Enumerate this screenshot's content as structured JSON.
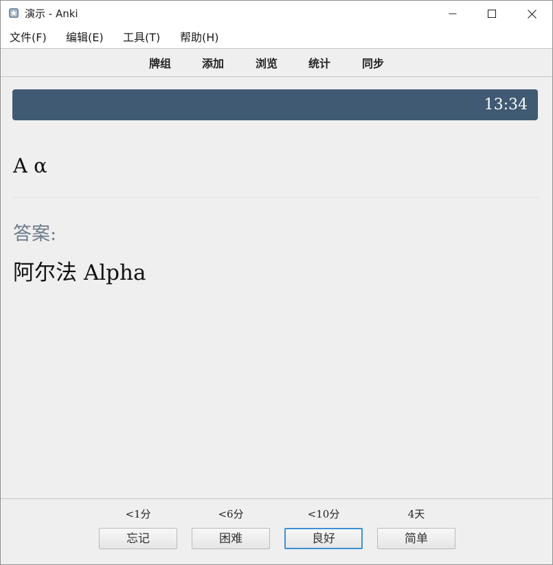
{
  "window": {
    "title": "演示 - Anki",
    "icon": "anki-app-icon"
  },
  "menu": [
    "文件(F)",
    "编辑(E)",
    "工具(T)",
    "帮助(H)"
  ],
  "toolbar": [
    "牌组",
    "添加",
    "浏览",
    "统计",
    "同步"
  ],
  "timer": "13:34",
  "card": {
    "question": "A α",
    "answer_label": "答案:",
    "answer": "阿尔法 Alpha"
  },
  "answer_buttons": [
    {
      "interval": "<1分",
      "label": "忘记"
    },
    {
      "interval": "<6分",
      "label": "困难"
    },
    {
      "interval": "<10分",
      "label": "良好",
      "default": true
    },
    {
      "interval": "4天",
      "label": "简单"
    }
  ],
  "colors": {
    "timer_bar": "#3f5a72",
    "answer_label": "#6d7b88",
    "default_button_border": "#3d8fd6"
  }
}
